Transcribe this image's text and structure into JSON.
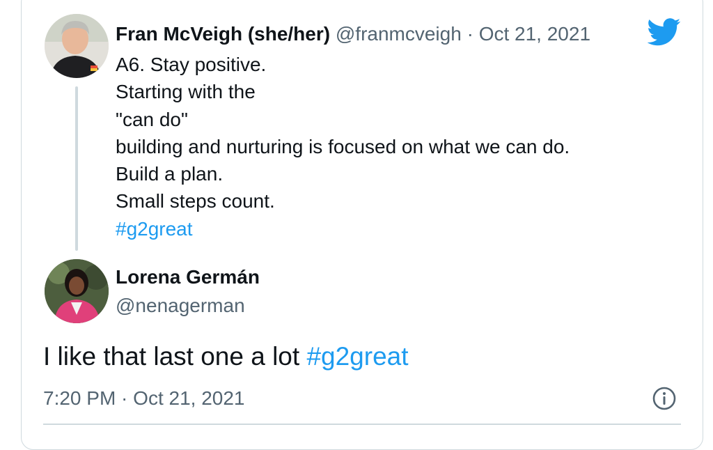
{
  "quoted_tweet": {
    "author_name": "Fran McVeigh (she/her)",
    "author_handle": "@franmcveigh",
    "separator": " · ",
    "date": "Oct 21, 2021",
    "lines": [
      "A6. Stay positive.",
      "Starting with the",
      "\"can do\"",
      "building and nurturing is focused on what we can do.",
      "Build a plan.",
      "Small steps count."
    ],
    "hashtag": "#g2great",
    "avatar_icon": "avatar-photo-fran"
  },
  "tweet": {
    "author_name": "Lorena Germán",
    "author_handle": "@nenagerman",
    "text": "I like that last one a lot ",
    "hashtag": "#g2great",
    "timestamp": "7:20 PM · Oct 21, 2021",
    "avatar_icon": "avatar-photo-lorena"
  },
  "icons": {
    "brand": "twitter-bird-icon",
    "info": "info-icon"
  },
  "colors": {
    "link": "#1d9bf0",
    "brand": "#1d9bf0",
    "secondary_text": "#536471",
    "primary_text": "#0f1419",
    "border": "#cfd9de"
  }
}
